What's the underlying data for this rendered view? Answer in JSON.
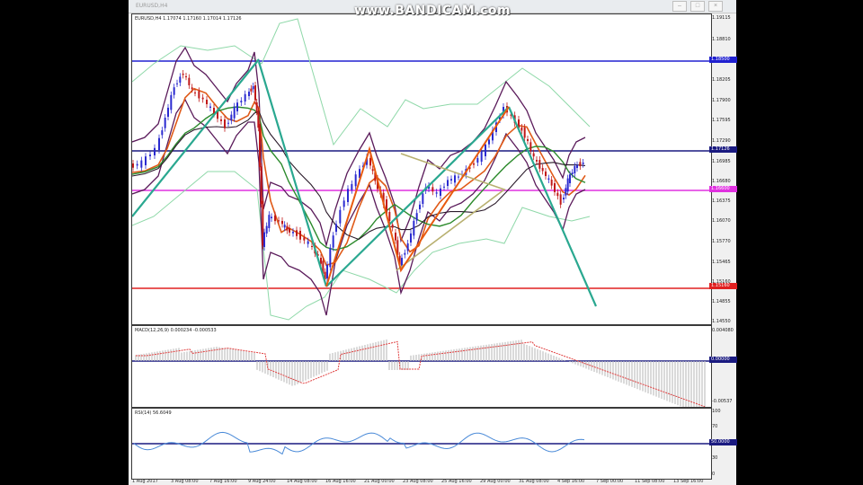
{
  "watermark": "www.BANDICAM.com",
  "window": {
    "tab_title": "EURUSD,H4",
    "buttons": [
      "–",
      "□",
      "×"
    ]
  },
  "main_chart": {
    "info": "EURUSD,H4  1.17074 1.17160 1.17014 1.17126",
    "price_labels": [
      "1.19115",
      "1.18810",
      "1.18500",
      "1.18205",
      "1.17900",
      "1.17595",
      "1.17290",
      "1.17126",
      "1.16985",
      "1.16680",
      "1.16375",
      "1.16070",
      "1.15770",
      "1.15465",
      "1.15160",
      "1.14855",
      "1.14550"
    ],
    "tags": [
      {
        "text": "1.18500",
        "color": "#2020d0"
      },
      {
        "text": "1.17126",
        "color": "#1a1a80"
      },
      {
        "text": "1.16600",
        "color": "#e030e0"
      },
      {
        "text": "1.15160",
        "color": "#e02020"
      }
    ]
  },
  "macd": {
    "info": "MACD(12,26,9) 0.000234 -0.000533",
    "labels": [
      "0.004080",
      "0.00000",
      "-0.00537"
    ]
  },
  "rsi": {
    "info": "RSI(14) 56.6049",
    "labels": [
      "100",
      "70",
      "50.0000",
      "30",
      "0"
    ]
  },
  "time_axis": [
    "1 Aug 2017",
    "3 Aug 08:00",
    "7 Aug 16:00",
    "9 Aug 24:00",
    "14 Aug 08:00",
    "16 Aug 16:00",
    "21 Aug 00:00",
    "23 Aug 08:00",
    "25 Aug 16:00",
    "29 Aug 00:00",
    "31 Aug 08:00",
    "4 Sep 16:00",
    "7 Sep 00:00",
    "11 Sep 08:00",
    "13 Sep 16:00"
  ],
  "colors": {
    "up_candle": "#2a2ad0",
    "down_candle": "#c01818",
    "resistance": "#2020d0",
    "support": "#e02020",
    "mid_line": "#e030e0",
    "zero_line": "#1a1a80",
    "trend": "#2aa890",
    "bands": "#5a1a5a",
    "outer_bands": "#8ed8a8",
    "ma_fast": "#e05a18",
    "ma_slow": "#2c8a2c",
    "macd_hist": "#c0c0c0",
    "macd_signal": "#e04040",
    "rsi_line": "#4a8ad8"
  }
}
